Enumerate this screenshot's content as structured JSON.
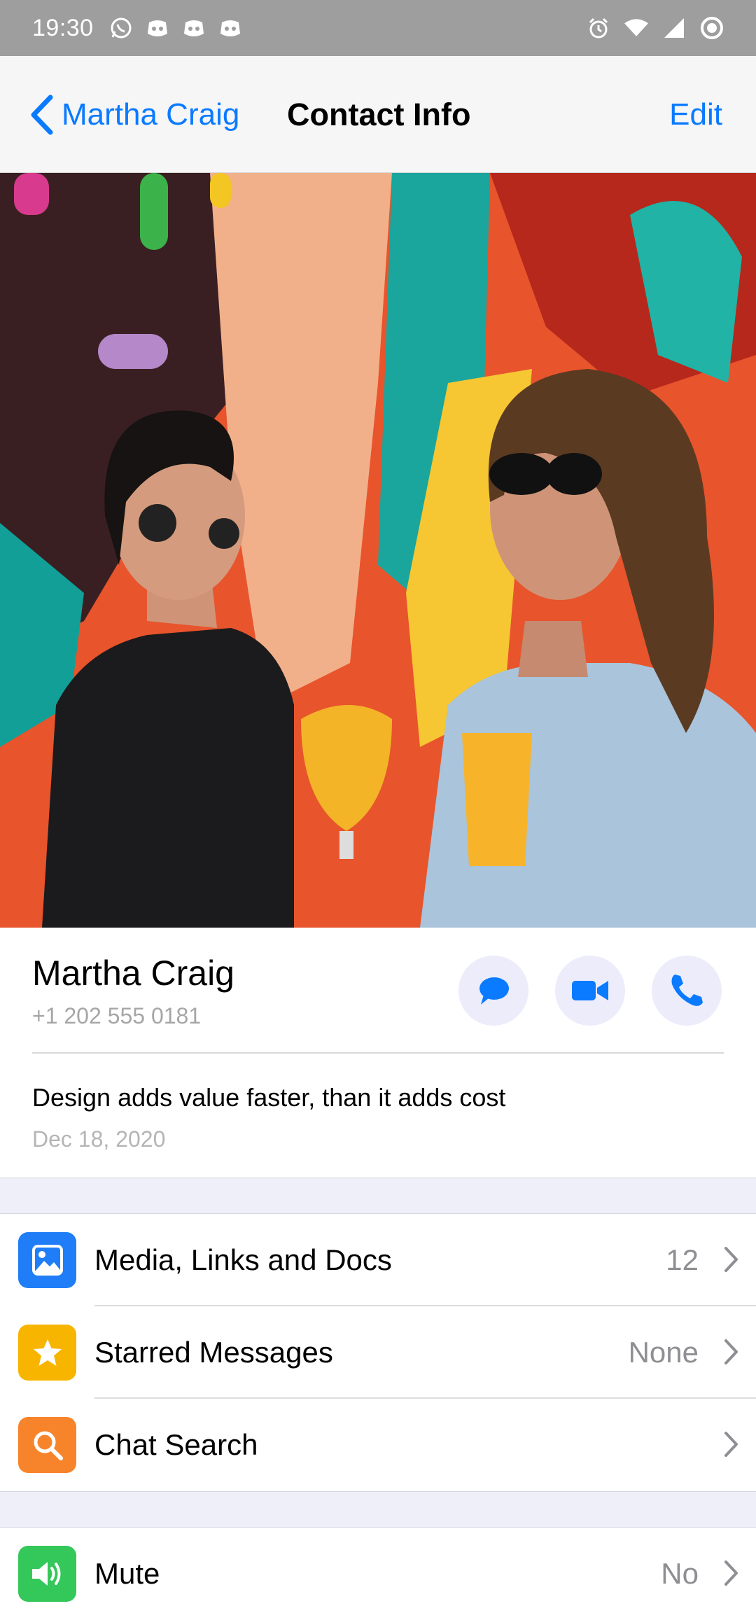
{
  "status_bar": {
    "time": "19:30",
    "left_icons": [
      "whatsapp-icon",
      "discord-icon",
      "discord-icon",
      "discord-icon"
    ],
    "right_icons": [
      "alarm-icon",
      "wifi-icon",
      "signal-icon",
      "sync-icon"
    ]
  },
  "nav": {
    "back_label": "Martha Craig",
    "title": "Contact Info",
    "edit_label": "Edit"
  },
  "profile": {
    "name": "Martha Craig",
    "phone": "+1 202 555 0181",
    "actions": [
      "message-icon",
      "video-call-icon",
      "phone-icon"
    ]
  },
  "about": {
    "text": "Design adds value faster, than it adds cost",
    "date": "Dec 18, 2020"
  },
  "rows": [
    {
      "label": "Media, Links and Docs",
      "value": "12",
      "icon": "image-icon",
      "color": "#1f7ef7"
    },
    {
      "label": "Starred Messages",
      "value": "None",
      "icon": "star-icon",
      "color": "#f7b500"
    },
    {
      "label": "Chat Search",
      "value": "",
      "icon": "search-icon",
      "color": "#f7842b"
    }
  ],
  "mute": {
    "label": "Mute",
    "value": "No",
    "icon": "speaker-icon",
    "color": "#34c759"
  },
  "colors": {
    "accent": "#0a7aff",
    "nav_bg": "#f6f6f6",
    "section_bg": "#efeffa"
  }
}
